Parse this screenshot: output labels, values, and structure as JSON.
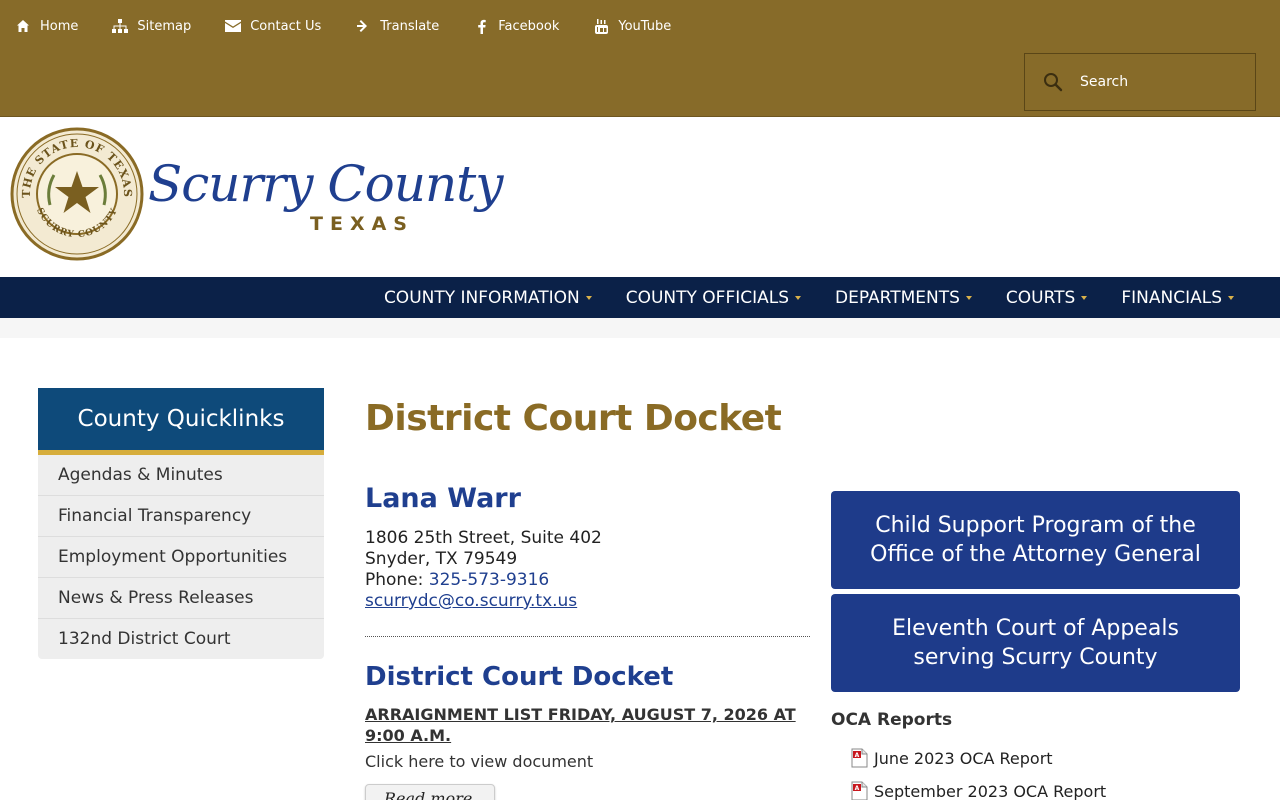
{
  "utility": {
    "items": [
      {
        "label": "Home",
        "icon": "home-icon"
      },
      {
        "label": "Sitemap",
        "icon": "sitemap-icon"
      },
      {
        "label": "Contact Us",
        "icon": "envelope-icon"
      },
      {
        "label": "Translate",
        "icon": "arrow-right-icon"
      },
      {
        "label": "Facebook",
        "icon": "facebook-icon"
      },
      {
        "label": "YouTube",
        "icon": "youtube-icon"
      }
    ],
    "search_placeholder": "Search"
  },
  "brand": {
    "name": "Scurry County",
    "state": "TEXAS",
    "seal_text_top": "THE STATE OF TEXAS",
    "seal_text_bottom": "SCURRY COUNTY"
  },
  "nav": {
    "items": [
      "COUNTY INFORMATION",
      "COUNTY OFFICIALS",
      "DEPARTMENTS",
      "COURTS",
      "FINANCIALS"
    ]
  },
  "sidebar": {
    "title": "County Quicklinks",
    "items": [
      "Agendas & Minutes",
      "Financial Transparency",
      "Employment Opportunities",
      "News & Press Releases",
      "132nd District Court"
    ]
  },
  "main": {
    "title": "District Court Docket",
    "contact": {
      "name": "Lana Warr",
      "address1": "1806 25th Street, Suite 402",
      "address2": "Snyder, TX 79549",
      "phone_label": "Phone: ",
      "phone": "325-573-9316",
      "email": "scurrydc@co.scurry.tx.us"
    },
    "docket_heading": "District Court Docket",
    "docket_item": "ARRAIGNMENT LIST FRIDAY, AUGUST 7, 2026 AT 9:00 A.M.",
    "click_text": "Click here to view document",
    "read_more": "Read more..."
  },
  "right": {
    "promos": [
      "Child Support Program of the Office of the Attorney General",
      "Eleventh Court of Appeals serving Scurry County"
    ],
    "oca_title": "OCA Reports",
    "oca_items": [
      "June 2023 OCA Report",
      "September 2023 OCA Report"
    ]
  },
  "colors": {
    "topbar": "#876b29",
    "nav": "#0b2148",
    "accent_gold": "#d6ad3c",
    "title_gold": "#8a6b25",
    "link_blue": "#1f3f8f",
    "promo_blue": "#1e3b8a"
  }
}
